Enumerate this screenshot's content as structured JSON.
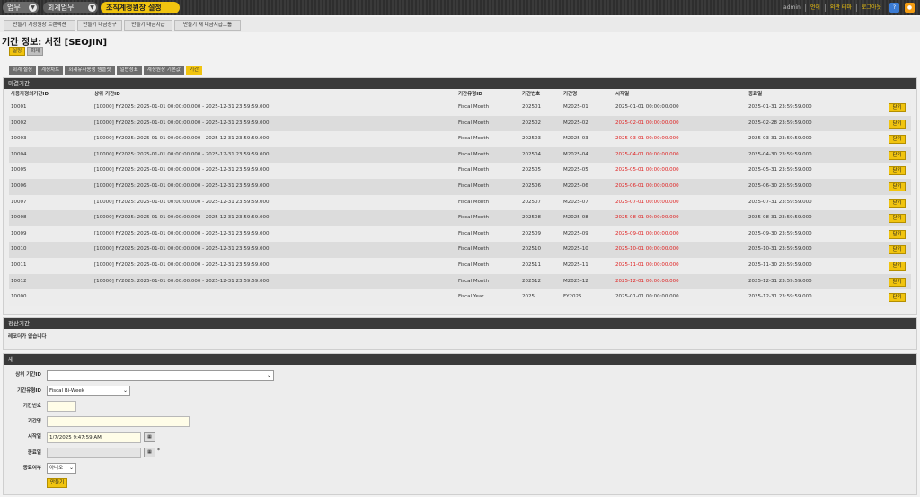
{
  "topbar": {
    "crumbs": [
      "업무",
      "회계업무",
      "조직계정원장 설정"
    ],
    "user": "admin",
    "links": [
      "언어",
      "외관 테마",
      "로그아웃"
    ]
  },
  "submenu": [
    "만들기 계정원장 트랜잭션",
    "만들기 대금청구",
    "만들기 대금지급",
    "만들기 새 대금지급그룹"
  ],
  "page_title": "기간 정보: 서진 [SEOJIN]",
  "tabs1": [
    "설정",
    "회계"
  ],
  "tabs2": [
    "회계 설정",
    "계정차트",
    "회계유사용행 템플릿",
    "일반정표",
    "계정원장 기본값",
    "기간"
  ],
  "open_periods": {
    "title": "미결기간",
    "headers": [
      "사용자정의기간ID",
      "상위 기간ID",
      "기간유형ID",
      "기간번호",
      "기간명",
      "시작일",
      "종료일"
    ],
    "close_label": "닫기",
    "rows": [
      [
        "10001",
        "[10000] FY2025: 2025-01-01 00:00:00.000 - 2025-12-31 23:59:59.000",
        "Fiscal Month",
        "202501",
        "M2025-01",
        "2025-01-01 00:00:00.000",
        "2025-01-31 23:59:59.000"
      ],
      [
        "10002",
        "[10000] FY2025: 2025-01-01 00:00:00.000 - 2025-12-31 23:59:59.000",
        "Fiscal Month",
        "202502",
        "M2025-02",
        "2025-02-01 00:00:00.000",
        "2025-02-28 23:59:59.000"
      ],
      [
        "10003",
        "[10000] FY2025: 2025-01-01 00:00:00.000 - 2025-12-31 23:59:59.000",
        "Fiscal Month",
        "202503",
        "M2025-03",
        "2025-03-01 00:00:00.000",
        "2025-03-31 23:59:59.000"
      ],
      [
        "10004",
        "[10000] FY2025: 2025-01-01 00:00:00.000 - 2025-12-31 23:59:59.000",
        "Fiscal Month",
        "202504",
        "M2025-04",
        "2025-04-01 00:00:00.000",
        "2025-04-30 23:59:59.000"
      ],
      [
        "10005",
        "[10000] FY2025: 2025-01-01 00:00:00.000 - 2025-12-31 23:59:59.000",
        "Fiscal Month",
        "202505",
        "M2025-05",
        "2025-05-01 00:00:00.000",
        "2025-05-31 23:59:59.000"
      ],
      [
        "10006",
        "[10000] FY2025: 2025-01-01 00:00:00.000 - 2025-12-31 23:59:59.000",
        "Fiscal Month",
        "202506",
        "M2025-06",
        "2025-06-01 00:00:00.000",
        "2025-06-30 23:59:59.000"
      ],
      [
        "10007",
        "[10000] FY2025: 2025-01-01 00:00:00.000 - 2025-12-31 23:59:59.000",
        "Fiscal Month",
        "202507",
        "M2025-07",
        "2025-07-01 00:00:00.000",
        "2025-07-31 23:59:59.000"
      ],
      [
        "10008",
        "[10000] FY2025: 2025-01-01 00:00:00.000 - 2025-12-31 23:59:59.000",
        "Fiscal Month",
        "202508",
        "M2025-08",
        "2025-08-01 00:00:00.000",
        "2025-08-31 23:59:59.000"
      ],
      [
        "10009",
        "[10000] FY2025: 2025-01-01 00:00:00.000 - 2025-12-31 23:59:59.000",
        "Fiscal Month",
        "202509",
        "M2025-09",
        "2025-09-01 00:00:00.000",
        "2025-09-30 23:59:59.000"
      ],
      [
        "10010",
        "[10000] FY2025: 2025-01-01 00:00:00.000 - 2025-12-31 23:59:59.000",
        "Fiscal Month",
        "202510",
        "M2025-10",
        "2025-10-01 00:00:00.000",
        "2025-10-31 23:59:59.000"
      ],
      [
        "10011",
        "[10000] FY2025: 2025-01-01 00:00:00.000 - 2025-12-31 23:59:59.000",
        "Fiscal Month",
        "202511",
        "M2025-11",
        "2025-11-01 00:00:00.000",
        "2025-11-30 23:59:59.000"
      ],
      [
        "10012",
        "[10000] FY2025: 2025-01-01 00:00:00.000 - 2025-12-31 23:59:59.000",
        "Fiscal Month",
        "202512",
        "M2025-12",
        "2025-12-01 00:00:00.000",
        "2025-12-31 23:59:59.000"
      ],
      [
        "10000",
        "",
        "Fiscal Year",
        "2025",
        "FY2025",
        "2025-01-01 00:00:00.000",
        "2025-12-31 23:59:59.000"
      ]
    ],
    "red_start": [
      false,
      true,
      true,
      true,
      true,
      true,
      true,
      true,
      true,
      true,
      true,
      true,
      false
    ]
  },
  "closed_periods": {
    "title": "정산기간",
    "empty_text": "레코더가 없습니다"
  },
  "new_form": {
    "title": "새",
    "fields": {
      "parent_label": "상위 기간ID",
      "parent_value": "",
      "type_label": "기간유형ID",
      "type_value": "Fiscal Bi-Week",
      "number_label": "기간번호",
      "number_value": "",
      "name_label": "기간명",
      "name_value": "",
      "start_label": "시작일",
      "start_value": "1/7/2025 9:47:59 AM",
      "end_label": "종료일",
      "end_value": "",
      "closed_label": "종료여부",
      "closed_value": "아니오"
    },
    "submit_label": "만들기"
  }
}
